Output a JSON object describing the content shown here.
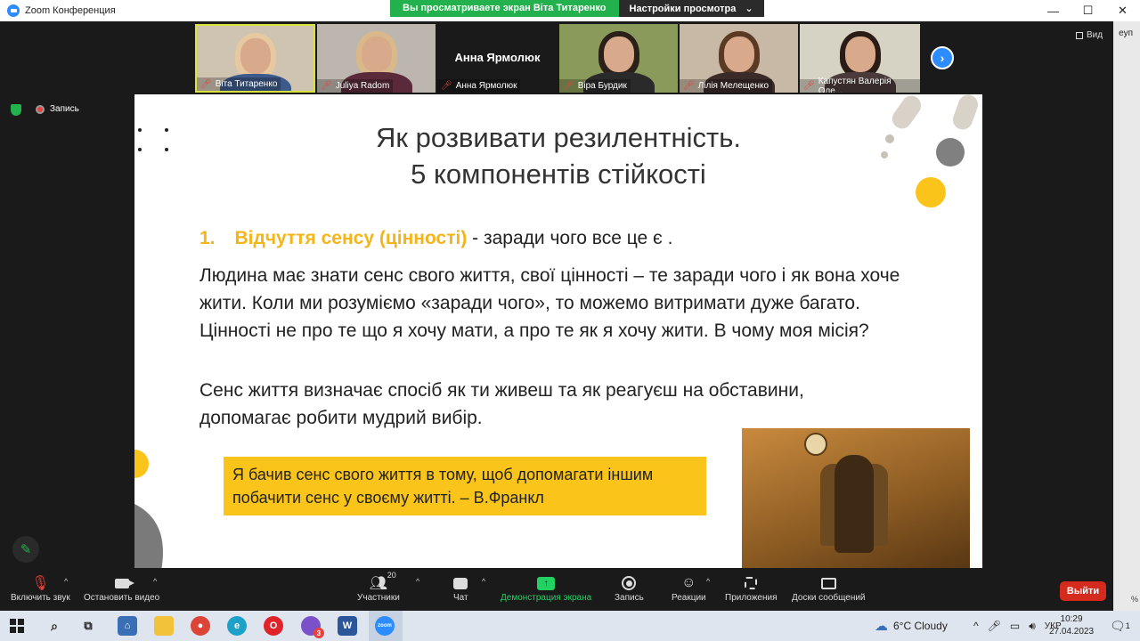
{
  "window": {
    "title": "Zoom Конференция",
    "share_banner": "Вы просматриваете экран Віта Титаренко",
    "view_options": "Настройки просмотра",
    "view_button": "Вид",
    "right_strip_text": "еуп",
    "right_strip_pct": "%"
  },
  "participants": [
    {
      "name": "Віта Титаренко",
      "hair": "#e6c9a0",
      "body": "#3c5a8a",
      "bg": "#cfc3b2"
    },
    {
      "name": "Juliya Radom",
      "hair": "#d9b98a",
      "body": "#5a2a3a",
      "bg": "#bcb6ae"
    },
    {
      "name": "Анна Ярмолюк",
      "big_name": "Анна Ярмолюк"
    },
    {
      "name": "Віра Бурдик",
      "hair": "#2a2018",
      "body": "#2a2a2a",
      "bg": "#8a9a5a"
    },
    {
      "name": "Лілія Мелещенко",
      "hair": "#5a3a22",
      "body": "#3a2a28",
      "bg": "#c7b9a6"
    },
    {
      "name": "Капустян Валерія Оле...",
      "hair": "#2a1c14",
      "body": "#4a3a3a",
      "bg": "#d6d2c4"
    }
  ],
  "recording": {
    "label": "Запись"
  },
  "slide": {
    "title_line1": "Як розвивати резилентність.",
    "title_line2": "5 компонентів стійкості",
    "point_num": "1.",
    "point_highlight": "Відчуття сенсу (цінності)",
    "point_rest": " - заради чого все це є .",
    "para1": "Людина має знати сенс свого життя, свої цінності – те заради чого і як вона хоче жити. Коли ми розуміємо «заради чого», то можемо витримати дуже багато. Цінності не про те що я хочу мати, а про те як я хочу жити. В чому моя місія?",
    "para2": "Сенс життя визначає спосіб як ти живеш та як реагуєш на обставини, допомагає робити мудрий вибір.",
    "quote": "Я бачив сенс свого життя в тому, щоб допомагати іншим побачити сенс у своєму житті. – В.Франкл",
    "accent": "#fbc41a"
  },
  "toolbar": {
    "audio": "Включить звук",
    "video": "Остановить видео",
    "participants": "Участники",
    "participants_count": "20",
    "chat": "Чат",
    "share": "Демонстрация экрана",
    "record": "Запись",
    "reactions": "Реакции",
    "apps": "Приложения",
    "whiteboards": "Доски сообщений",
    "leave": "Выйти"
  },
  "taskbar": {
    "weather": "6°C  Cloudy",
    "language": "УКР",
    "time": "10:29",
    "date": "27.04.2023",
    "viber_badge": "3",
    "notif_count": "1"
  }
}
